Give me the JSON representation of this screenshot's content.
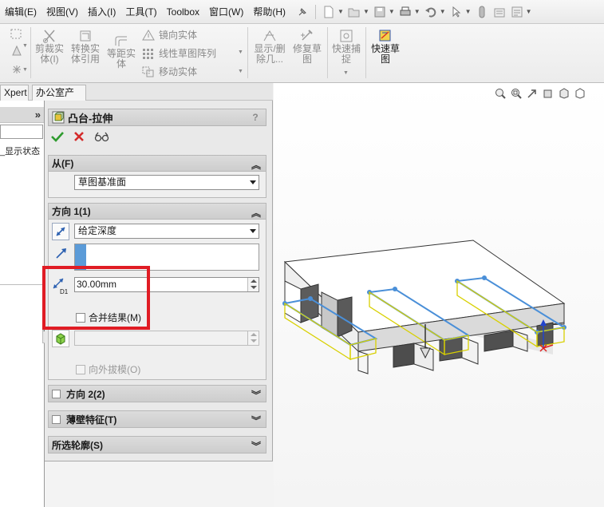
{
  "menubar": {
    "items": [
      "编辑(E)",
      "视图(V)",
      "插入(I)",
      "工具(T)",
      "Toolbox",
      "窗口(W)",
      "帮助(H)"
    ]
  },
  "ribbon": {
    "trim": "剪裁实\n体(I)",
    "convert": "转换实\n体引用",
    "offset": "等距实\n体",
    "mirror": "镜向实体",
    "linear_pattern": "线性草图阵列",
    "move": "移动实体",
    "show_delete": "显示/删\n除几...",
    "repair": "修复草\n图",
    "quick_snap": "快速捕\n捉",
    "rapid_sketch": "快速草\n图"
  },
  "tabs": [
    "Xpert",
    "办公室产品"
  ],
  "tree": {
    "item": "_显示状态"
  },
  "property_manager": {
    "title": "凸台-拉伸",
    "help": "?",
    "from": {
      "title": "从(F)",
      "value": "草图基准面"
    },
    "direction1": {
      "title": "方向 1(1)",
      "end_condition": "给定深度",
      "depth": "30.00mm",
      "depth_icon_label": "D1",
      "merge_result": "合并结果(M)",
      "draft_outward": "向外拔模(O)"
    },
    "direction2": {
      "title": "方向 2(2)"
    },
    "thin_feature": {
      "title": "薄壁特征(T)"
    },
    "selected_contours": {
      "title": "所选轮廓(S)"
    }
  },
  "colors": {
    "highlight_box": "#e01c24",
    "accent_blue": "#5b9bd8",
    "ok_green": "#2e9b2e",
    "cancel_red": "#d42a2a"
  }
}
